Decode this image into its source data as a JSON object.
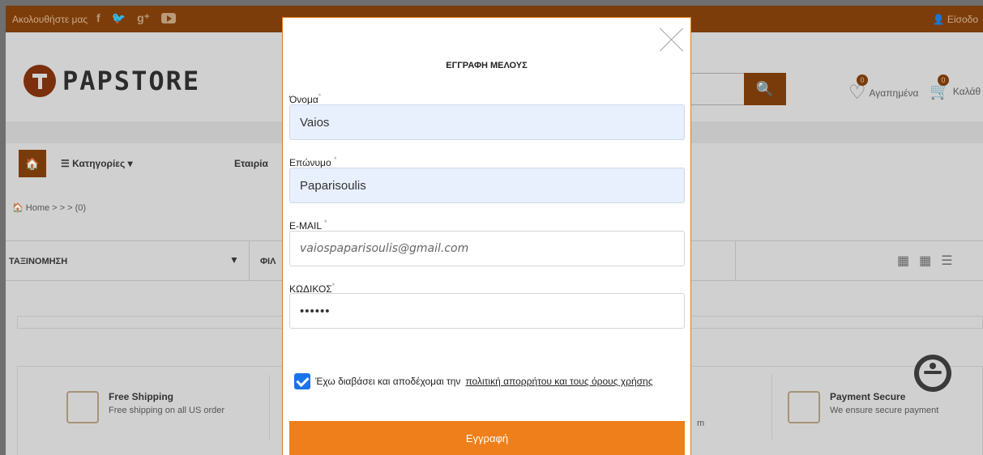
{
  "topbar": {
    "follow_label": "Ακολουθήστε μας",
    "social": [
      {
        "icon": "facebook-icon",
        "glyph": "f"
      },
      {
        "icon": "twitter-icon",
        "glyph": "🐦"
      },
      {
        "icon": "google-plus-icon",
        "glyph": "g⁺"
      }
    ],
    "login_label": "👤 Είσοδο"
  },
  "header": {
    "logo_text": "PAPSTORE",
    "search_icon": "🔍",
    "wishlist": {
      "count": "0",
      "label": "Αγαπημένα"
    },
    "cart": {
      "count": "0",
      "label": "Καλάθ"
    }
  },
  "nav": {
    "home_icon": "🏠",
    "categories_label": "☰ Κατηγορίες ▾",
    "company_label": "Εταιρία"
  },
  "breadcrumb": "🏠 Home > > > (0)",
  "sortbar": {
    "sort_label": "ΤΑΞΙΝΟΜΗΣΗ",
    "caret": "▼",
    "filter_label": "ΦΙΛ",
    "views": [
      "▦",
      "▦",
      "☰"
    ]
  },
  "features": [
    {
      "title": "Free Shipping",
      "desc": "Free shipping on all US order"
    },
    {
      "title": "Payment Secure",
      "desc": "We ensure secure payment"
    }
  ],
  "feature_partial": "m",
  "modal": {
    "title": "ΕΓΓΡΑΦΗ ΜΕΛΟΥΣ",
    "first_name": {
      "label": "Όνομα",
      "req": "*",
      "value": "Vaios"
    },
    "last_name": {
      "label": "Επώνυμο",
      "req": "*",
      "value": "Paparisoulis"
    },
    "email": {
      "label": "E-MAIL",
      "req": "*",
      "value": "vaiospaparisoulis@gmail.com"
    },
    "password": {
      "label": "ΚΩΔΙΚΟΣ",
      "req": "*",
      "value": "••••••"
    },
    "agree_text": "Έχω διαβάσει και αποδέχομαι την",
    "agree_link": "πολιτική απορρήτου και τους όρους χρήσης",
    "submit_label": "Εγγραφή"
  }
}
